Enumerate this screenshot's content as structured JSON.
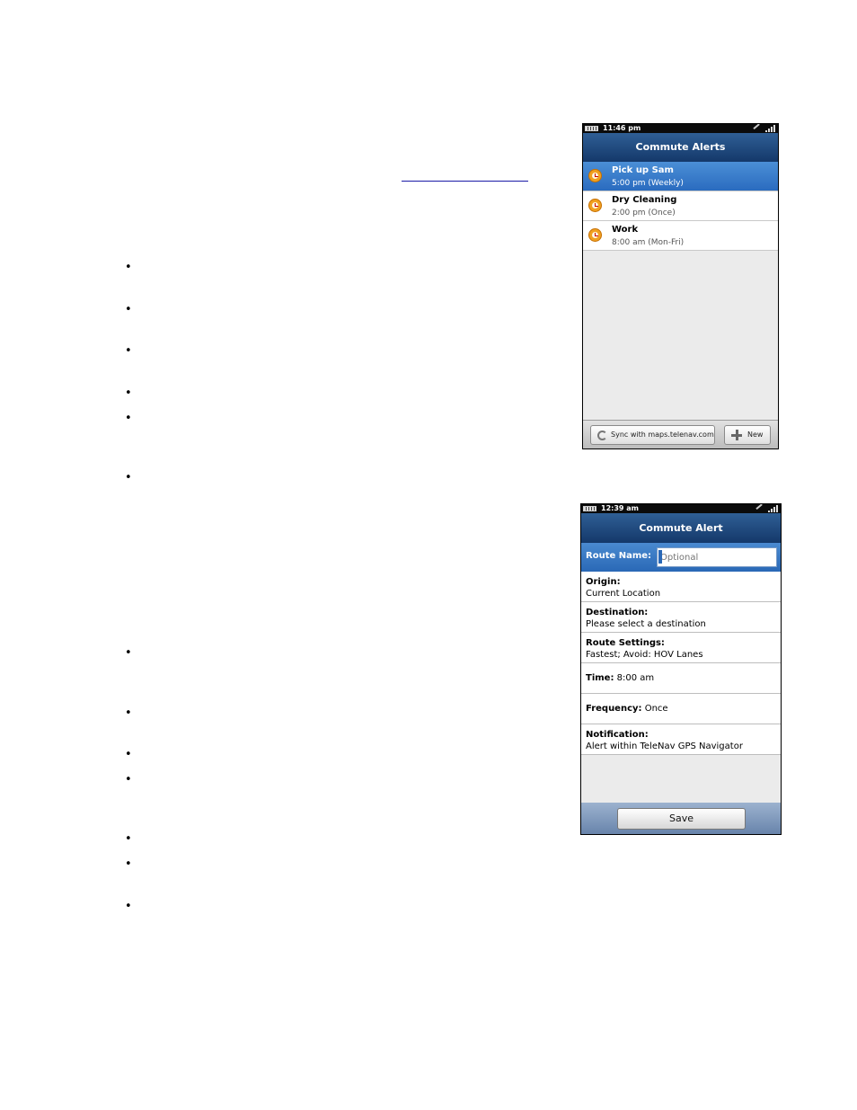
{
  "document": {
    "bullet_glyph": "•"
  },
  "screen1": {
    "status_time": "11:46 pm",
    "title": "Commute Alerts",
    "alerts": [
      {
        "title": "Pick up Sam",
        "subtitle": "5:00 pm (Weekly)",
        "selected": true
      },
      {
        "title": "Dry Cleaning",
        "subtitle": "2:00 pm (Once)",
        "selected": false
      },
      {
        "title": "Work",
        "subtitle": "8:00 am (Mon-Fri)",
        "selected": false
      }
    ],
    "sync_button": "Sync with maps.telenav.com",
    "new_button": "New"
  },
  "screen2": {
    "status_time": "12:39 am",
    "title": "Commute Alert",
    "route_name_label": "Route Name:",
    "route_name_placeholder": "Optional",
    "origin_label": "Origin:",
    "origin_value": "Current Location",
    "destination_label": "Destination:",
    "destination_value": "Please select a destination",
    "route_settings_label": "Route Settings:",
    "route_settings_value": "Fastest; Avoid: HOV Lanes",
    "time_label": "Time:",
    "time_value": "8:00 am",
    "frequency_label": "Frequency:",
    "frequency_value": "Once",
    "notification_label": "Notification:",
    "notification_value": "Alert within TeleNav GPS Navigator",
    "save_button": "Save"
  },
  "colors": {
    "title_bar": "#1f4b82",
    "selected_row": "#3a7ccb",
    "alarm_icon": "#f0a020"
  }
}
